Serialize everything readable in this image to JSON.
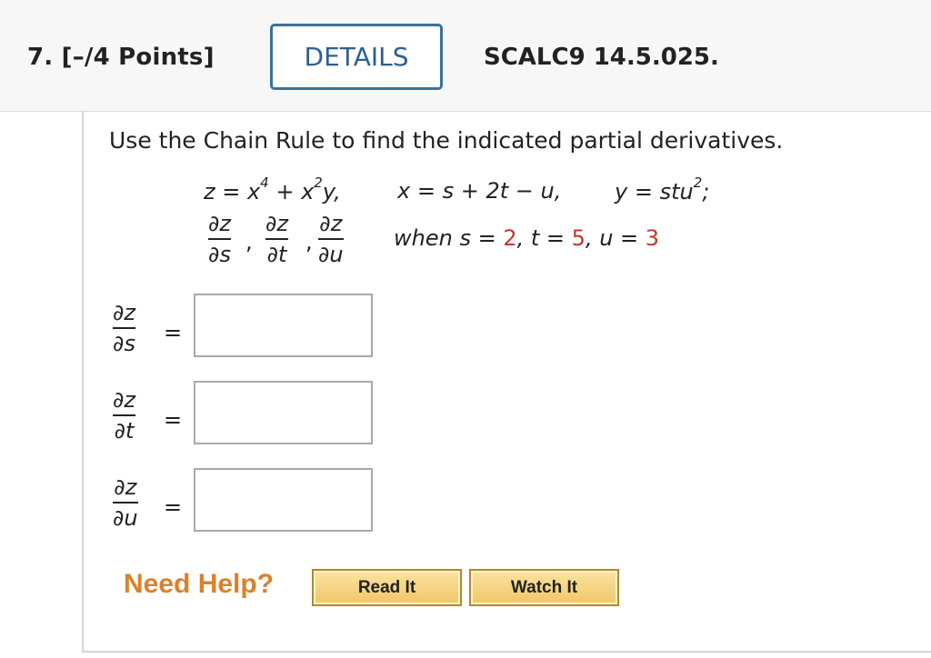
{
  "header": {
    "question_number": "7.",
    "points": "[–/4 Points]",
    "details_label": "DETAILS",
    "reference": "SCALC9 14.5.025."
  },
  "problem": {
    "prompt": "Use the Chain Rule to find the indicated partial derivatives.",
    "z_eq_prefix": "z = x",
    "z_exp1": "4",
    "z_eq_mid": " + x",
    "z_exp2": "2",
    "z_eq_suffix": "y,",
    "x_eq": "x = s + 2t − u,",
    "y_eq_prefix": "y = stu",
    "y_exp": "2",
    "y_eq_suffix": ";",
    "partials": [
      {
        "num": "∂z",
        "den": "∂s"
      },
      {
        "num": "∂z",
        "den": "∂t"
      },
      {
        "num": "∂z",
        "den": "∂u"
      }
    ],
    "when_label": "when s = ",
    "s_value": "2",
    "t_label": ", t = ",
    "t_value": "5",
    "u_label": ", u = ",
    "u_value": "3"
  },
  "answers": [
    {
      "num": "∂z",
      "den": "∂s",
      "equals": "=",
      "value": ""
    },
    {
      "num": "∂z",
      "den": "∂t",
      "equals": "=",
      "value": ""
    },
    {
      "num": "∂z",
      "den": "∂u",
      "equals": "=",
      "value": ""
    }
  ],
  "help": {
    "label": "Need Help?",
    "read_it": "Read It",
    "watch_it": "Watch It"
  },
  "colors": {
    "accent_red": "#c0392b",
    "details_border": "#3a6f9e",
    "need_help": "#d9822b"
  }
}
